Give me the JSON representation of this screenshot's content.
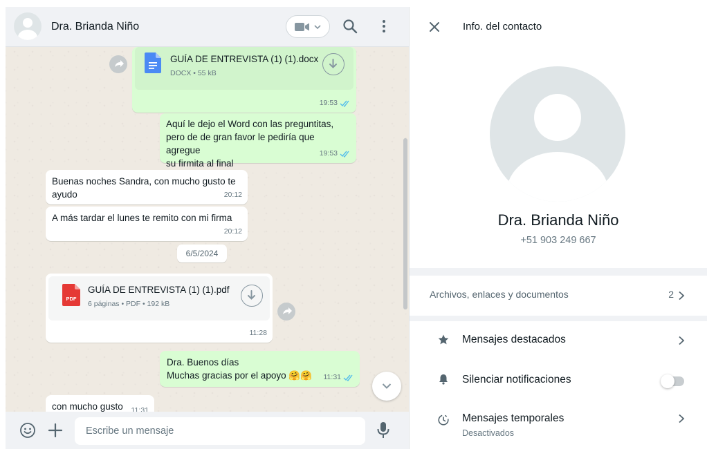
{
  "chat": {
    "contact_name": "Dra. Brianda Niño",
    "video_icon": "video-camera-icon",
    "search_icon": "search-icon",
    "menu_icon": "more-vertical-icon",
    "messages": {
      "m1": {
        "file_name": "GUÍA DE ENTREVISTA (1) (1).docx",
        "meta": "DOCX • 55 kB",
        "time": "19:53",
        "icon": "word-document-icon"
      },
      "m2": {
        "line1": "Aquí le dejo el Word con las preguntitas,",
        "line2": "pero de de gran favor le pediría que agregue",
        "line3": "su firmita al final",
        "time": "19:53"
      },
      "m3": {
        "line1": "Buenas noches Sandra, con mucho gusto te",
        "line2": "ayudo",
        "time": "20:12"
      },
      "m4": {
        "text": "A más tardar el lunes te remito con mi firma",
        "time": "20:12"
      },
      "date_divider": "6/5/2024",
      "m5": {
        "file_name": "GUÍA DE ENTREVISTA (1) (1).pdf",
        "meta": "6 páginas • PDF • 192 kB",
        "time": "11:28",
        "icon_label": "PDF"
      },
      "m6": {
        "line1": "Dra. Buenos días",
        "line2": "Muchas gracias por el apoyo",
        "emoji": "🤗🤗",
        "time": "11:31"
      },
      "m7": {
        "text": "con mucho gusto",
        "time": "11:31"
      }
    },
    "composer": {
      "placeholder": "Escribe un mensaje",
      "emoji_icon": "emoji-icon",
      "attach_icon": "plus-icon",
      "mic_icon": "microphone-icon"
    }
  },
  "info": {
    "title": "Info. del contacto",
    "name": "Dra. Brianda Niño",
    "phone": "+51 903 249 667",
    "media": {
      "label": "Archivos, enlaces y documentos",
      "count": "2"
    },
    "starred": {
      "label": "Mensajes destacados",
      "icon": "star-icon"
    },
    "mute": {
      "label": "Silenciar notificaciones",
      "icon": "bell-icon",
      "enabled": false
    },
    "disappearing": {
      "label": "Mensajes temporales",
      "sub": "Desactivados",
      "icon": "timer-icon"
    }
  },
  "colors": {
    "outgoing": "#d9fdd3",
    "incoming": "#ffffff",
    "chat_bg": "#efeae2",
    "ticks": "#53bdeb",
    "pdf_red": "#e53935",
    "doc_blue": "#4a8af4"
  }
}
